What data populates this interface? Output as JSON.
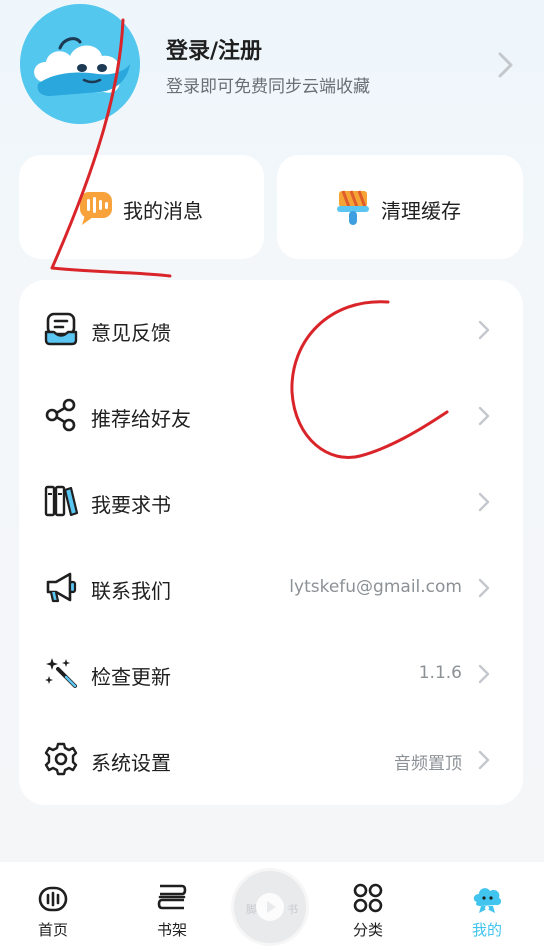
{
  "profile": {
    "title": "登录/注册",
    "subtitle": "登录即可免费同步云端收藏",
    "avatar_icon": "cloud-mascot-icon"
  },
  "quick_actions": [
    {
      "label": "我的消息",
      "icon": "message-icon"
    },
    {
      "label": "清理缓存",
      "icon": "broom-icon"
    }
  ],
  "menu": [
    {
      "label": "意见反馈",
      "value": "",
      "icon": "feedback-inbox-icon"
    },
    {
      "label": "推荐给好友",
      "value": "",
      "icon": "share-icon"
    },
    {
      "label": "我要求书",
      "value": "",
      "icon": "books-icon"
    },
    {
      "label": "联系我们",
      "value": "lytskefu@gmail.com",
      "icon": "megaphone-icon"
    },
    {
      "label": "检查更新",
      "value": "1.1.6",
      "icon": "magic-wand-icon"
    },
    {
      "label": "系统设置",
      "value": "音频置顶",
      "icon": "gear-icon"
    }
  ],
  "nav": {
    "items": [
      {
        "label": "首页",
        "icon": "home-radio-icon"
      },
      {
        "label": "书架",
        "icon": "bookshelf-icon"
      },
      {
        "label": "分类",
        "icon": "category-grid-icon"
      },
      {
        "label": "我的",
        "icon": "mascot-profile-icon"
      }
    ],
    "center_text_left": "脚",
    "center_text_right": "书",
    "center_icon": "play-icon",
    "active_index": 3
  },
  "colors": {
    "accent": "#41c4ee",
    "annotation": "#d9252a",
    "card_bg": "#ffffff",
    "page_bg": "#f3f7fa"
  }
}
